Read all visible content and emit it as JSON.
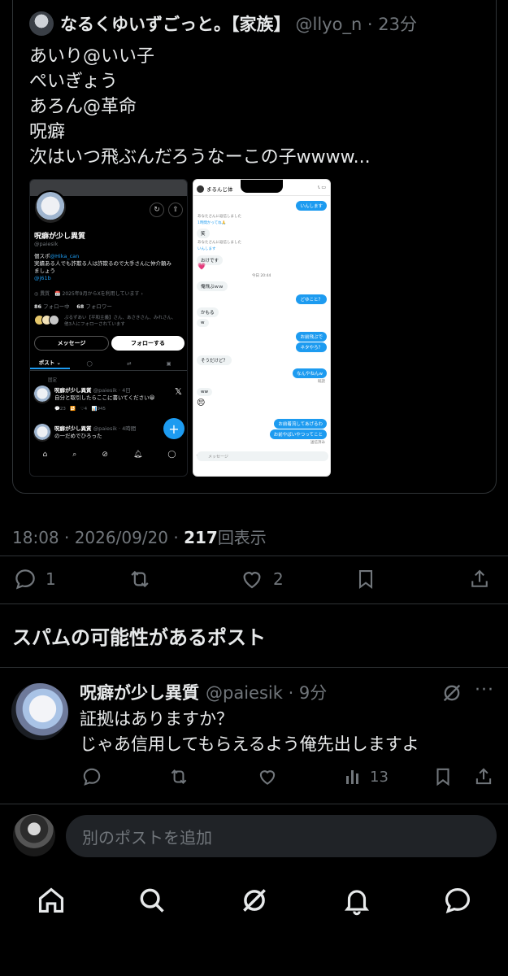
{
  "quoted_post": {
    "display_name": "なるくゆいずごっと。【家族】",
    "handle_time": "@llyo_n · 23分",
    "lines": [
      "あいり@いい子",
      "ぺいぎょう",
      "あろん@革命",
      "呪癖",
      "次はいつ飛ぶんだろうなーこの子wwww..."
    ]
  },
  "profile_shot": {
    "name": "呪癖が少し異質",
    "handle": "@paiesik",
    "bio_line1_prefix": "個スポ",
    "bio_link1": "@Hika_can",
    "bio_line2": "実績ある人でも詐欺る人は詐欺るので大手さんに仲介頼み",
    "bio_line3": "ましょう",
    "bio_link2": "@j61b",
    "meta": "◎ 異質　📅 2025年9月からXを利用しています ›",
    "following_count": "86",
    "following_label": "フォロー中",
    "followers_count": "68",
    "followers_label": "フォロワー",
    "mutuals_line1": "ぷるずあい【平和主義】さん、あさきさん、みれさん、",
    "mutuals_line2": "他3人にフォローされています",
    "message_btn": "メッセージ",
    "follow_btn": "フォローする",
    "tab_posts": "ポスト ⌄",
    "pinned_label": "固定",
    "post1_name": "呪癖が少し異質",
    "post1_meta": "@paiesik · 4日",
    "post1_body": "自分と取引したらここに書いてください😀",
    "post1_stats": "💬23　🔁　♡4　📊945",
    "post2_name": "呪癖が少し異質",
    "post2_meta": "@paiesik · 4時間",
    "post2_body": "の一だめでひろった",
    "fab": "+"
  },
  "dm_shot": {
    "title": "まるんじ体",
    "messages": [
      {
        "dir": "out",
        "text": "いんします"
      },
      {
        "dir": "in",
        "text": "あなたさんに返信しました",
        "style": "gray"
      },
      {
        "dir": "in",
        "text": "1時間かってね🙏",
        "style": "blue"
      },
      {
        "dir": "in",
        "text": "笑"
      },
      {
        "dir": "in",
        "text": "あなたさんに返信しました",
        "style": "gray"
      },
      {
        "dir": "in",
        "text": "いんします",
        "style": "blue"
      },
      {
        "dir": "in",
        "text": "おけです"
      },
      {
        "dir": "in",
        "text": "今日 20:44",
        "style": "center"
      },
      {
        "dir": "in",
        "text": "俺飛ぶｗｗ"
      },
      {
        "dir": "out",
        "text": "どゆこと？"
      },
      {
        "dir": "in",
        "text": "かもる"
      },
      {
        "dir": "in",
        "text": "w"
      },
      {
        "dir": "out",
        "text": "お前飛ぶで"
      },
      {
        "dir": "out",
        "text": "ネタやろ？"
      },
      {
        "dir": "in",
        "text": "そうだけど？"
      },
      {
        "dir": "out",
        "text": "なんやねんw"
      },
      {
        "dir": "in",
        "text": "ww"
      },
      {
        "dir": "out",
        "text": "お前着流してあげるわ"
      },
      {
        "dir": "out",
        "text": "お前やばいやつってこと"
      }
    ],
    "read_label": "既読",
    "read_label2": "送信済み",
    "input_placeholder": "メッセージ"
  },
  "meta": {
    "time_date": "18:08 · 2026/09/20 · ",
    "views_count": "217",
    "views_label": "回表示"
  },
  "actions": {
    "replies": "1",
    "likes": "2"
  },
  "spam_section_title": "スパムの可能性があるポスト",
  "reply": {
    "display_name": "呪癖が少し異質",
    "handle_time": "@paiesik · 9分",
    "lines": [
      "証拠はありますか？",
      "じゃあ信用してもらえるよう俺先出しますよ"
    ],
    "views": "13"
  },
  "composer": {
    "placeholder": "別のポストを追加"
  },
  "colors": {
    "background": "#000000",
    "text": "#e7e9ea",
    "muted": "#71767b",
    "accent": "#1d9bf0",
    "border": "#2f3336"
  },
  "icons": [
    "reply-icon",
    "repost-icon",
    "like-icon",
    "bookmark-icon",
    "share-icon",
    "views-icon",
    "grok-icon",
    "more-icon",
    "home-icon",
    "search-icon",
    "notifications-icon",
    "messages-icon"
  ]
}
